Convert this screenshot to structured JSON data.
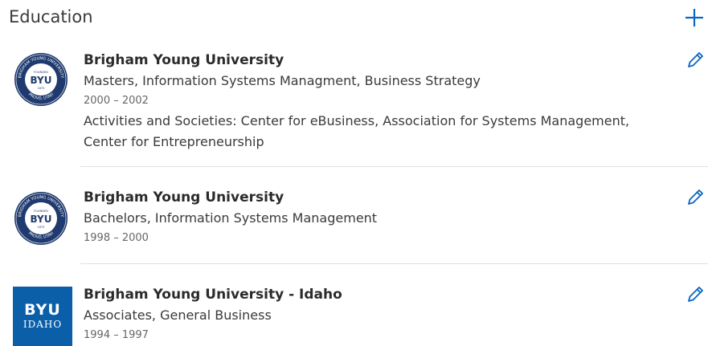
{
  "section": {
    "title": "Education",
    "add_icon": "plus-icon",
    "accent_color": "#0a66c2"
  },
  "entries": [
    {
      "school": "Brigham Young University",
      "degree": "Masters, Information Systems Managment, Business Strategy",
      "dates": "2000 – 2002",
      "activities": "Activities and Societies: Center for eBusiness, Association for Systems Management, Center for Entrepreneurship",
      "logo": {
        "text": "BYU",
        "founded": "FOUNDED",
        "year": "1875",
        "ring_top": "BRIGHAM YOUNG UNIVERSITY",
        "ring_bottom": "PROVO, UTAH"
      },
      "edit_icon": "pencil-icon"
    },
    {
      "school": "Brigham Young University",
      "degree": "Bachelors, Information Systems Management",
      "dates": "1998 – 2000",
      "logo": {
        "text": "BYU",
        "founded": "FOUNDED",
        "year": "1875",
        "ring_top": "BRIGHAM YOUNG UNIVERSITY",
        "ring_bottom": "PROVO, UTAH"
      },
      "edit_icon": "pencil-icon"
    },
    {
      "school": "Brigham Young University - Idaho",
      "degree": "Associates, General Business",
      "dates": "1994 – 1997",
      "logo": {
        "line1": "BYU",
        "line2": "IDAHO"
      },
      "edit_icon": "pencil-icon"
    }
  ]
}
